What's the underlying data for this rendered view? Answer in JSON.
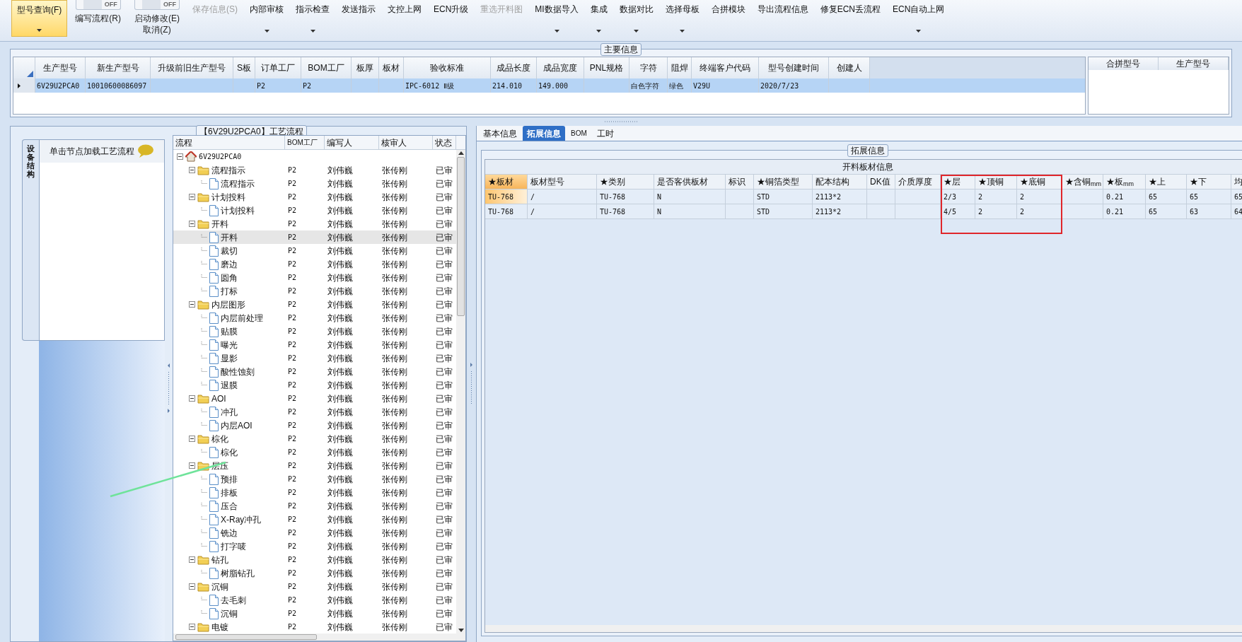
{
  "toolbar": [
    {
      "kind": "button",
      "label": "型号查询(F)",
      "selected": true,
      "dropdown": true,
      "disabled": false
    },
    {
      "kind": "toggle",
      "switch": "OFF",
      "label": "编写流程(R)",
      "on": false
    },
    {
      "kind": "toggle",
      "switch": "OFF",
      "label": "启动修改(E)",
      "sublabel": "取消(Z)",
      "on": false
    },
    {
      "kind": "button",
      "label": "保存信息(S)",
      "selected": false,
      "dropdown": false,
      "disabled": true
    },
    {
      "kind": "button",
      "label": "内部审核",
      "selected": false,
      "dropdown": true,
      "disabled": false
    },
    {
      "kind": "button",
      "label": "指示检查",
      "selected": false,
      "dropdown": true,
      "disabled": false
    },
    {
      "kind": "button",
      "label": "发送指示",
      "selected": false,
      "dropdown": false,
      "disabled": false
    },
    {
      "kind": "button",
      "label": "文控上网",
      "selected": false,
      "dropdown": false,
      "disabled": false
    },
    {
      "kind": "button",
      "label": "ECN升级",
      "selected": false,
      "dropdown": false,
      "disabled": false
    },
    {
      "kind": "button",
      "label": "重选开料图",
      "selected": false,
      "dropdown": false,
      "disabled": true
    },
    {
      "kind": "button",
      "label": "MI数据导入",
      "selected": false,
      "dropdown": true,
      "disabled": false
    },
    {
      "kind": "button",
      "label": "集成",
      "selected": false,
      "dropdown": true,
      "disabled": false
    },
    {
      "kind": "button",
      "label": "数据对比",
      "selected": false,
      "dropdown": true,
      "disabled": false
    },
    {
      "kind": "button",
      "label": "选择母板",
      "selected": false,
      "dropdown": true,
      "disabled": false
    },
    {
      "kind": "button",
      "label": "合拼模块",
      "selected": false,
      "dropdown": false,
      "disabled": false
    },
    {
      "kind": "button",
      "label": "导出流程信息",
      "selected": false,
      "dropdown": false,
      "disabled": false
    },
    {
      "kind": "button",
      "label": "修复ECN丢流程",
      "selected": false,
      "dropdown": false,
      "disabled": false
    },
    {
      "kind": "button",
      "label": "ECN自动上网",
      "selected": false,
      "dropdown": true,
      "disabled": false
    }
  ],
  "main_info": {
    "title": "主要信息",
    "columns": [
      "生产型号",
      "新生产型号",
      "升级前旧生产型号",
      "S板",
      "订单工厂",
      "BOM工厂",
      "板厚",
      "板材",
      "验收标准",
      "成品长度",
      "成品宽度",
      "PNL规格",
      "字符",
      "阻焊",
      "终端客户代码",
      "型号创建时间",
      "创建人"
    ],
    "rows": [
      {
        "selected": true,
        "cells": [
          "6V29U2PCA0",
          "10010600086097",
          null,
          null,
          "P2",
          "P2",
          null,
          null,
          "IPC-6012 Ⅱ级",
          "214.010",
          "149.000",
          null,
          "白色字符",
          "绿色",
          "V29U",
          "2020/7/23",
          null
        ]
      }
    ],
    "merge_table": {
      "columns": [
        "合拼型号",
        "生产型号"
      ]
    }
  },
  "side_tab": {
    "label": "设备结构",
    "hint": "单击节点加载工艺流程"
  },
  "flow": {
    "title": "【6V29U2PCA0】工艺流程",
    "columns": [
      "流程",
      "BOM工厂",
      "编写人",
      "核审人",
      "状态"
    ],
    "tree": [
      {
        "kind": "root",
        "label": "6V29U2PCA0",
        "expanded": true,
        "selected": false,
        "children": [
          {
            "kind": "folder",
            "label": "流程指示",
            "bom": "P2",
            "writer": "刘伟巍",
            "reviewer": "张传刚",
            "status": "已审",
            "expanded": true,
            "selected": false,
            "children": [
              {
                "kind": "file",
                "label": "流程指示",
                "bom": "P2",
                "writer": "刘伟巍",
                "reviewer": "张传刚",
                "status": "已审",
                "selected": false
              }
            ]
          },
          {
            "kind": "folder",
            "label": "计划投料",
            "bom": "P2",
            "writer": "刘伟巍",
            "reviewer": "张传刚",
            "status": "已审",
            "expanded": true,
            "selected": false,
            "children": [
              {
                "kind": "file",
                "label": "计划投料",
                "bom": "P2",
                "writer": "刘伟巍",
                "reviewer": "张传刚",
                "status": "已审",
                "selected": false
              }
            ]
          },
          {
            "kind": "folder",
            "label": "开料",
            "bom": "P2",
            "writer": "刘伟巍",
            "reviewer": "张传刚",
            "status": "已审",
            "expanded": true,
            "selected": false,
            "children": [
              {
                "kind": "file",
                "label": "开料",
                "bom": "P2",
                "writer": "刘伟巍",
                "reviewer": "张传刚",
                "status": "已审",
                "selected": true
              },
              {
                "kind": "file",
                "label": "裁切",
                "bom": "P2",
                "writer": "刘伟巍",
                "reviewer": "张传刚",
                "status": "已审",
                "selected": false
              },
              {
                "kind": "file",
                "label": "磨边",
                "bom": "P2",
                "writer": "刘伟巍",
                "reviewer": "张传刚",
                "status": "已审",
                "selected": false
              },
              {
                "kind": "file",
                "label": "圆角",
                "bom": "P2",
                "writer": "刘伟巍",
                "reviewer": "张传刚",
                "status": "已审",
                "selected": false
              },
              {
                "kind": "file",
                "label": "打标",
                "bom": "P2",
                "writer": "刘伟巍",
                "reviewer": "张传刚",
                "status": "已审",
                "selected": false
              }
            ]
          },
          {
            "kind": "folder",
            "label": "内层图形",
            "bom": "P2",
            "writer": "刘伟巍",
            "reviewer": "张传刚",
            "status": "已审",
            "expanded": true,
            "selected": false,
            "children": [
              {
                "kind": "file",
                "label": "内层前处理",
                "bom": "P2",
                "writer": "刘伟巍",
                "reviewer": "张传刚",
                "status": "已审",
                "selected": false
              },
              {
                "kind": "file",
                "label": "贴膜",
                "bom": "P2",
                "writer": "刘伟巍",
                "reviewer": "张传刚",
                "status": "已审",
                "selected": false
              },
              {
                "kind": "file",
                "label": "曝光",
                "bom": "P2",
                "writer": "刘伟巍",
                "reviewer": "张传刚",
                "status": "已审",
                "selected": false
              },
              {
                "kind": "file",
                "label": "显影",
                "bom": "P2",
                "writer": "刘伟巍",
                "reviewer": "张传刚",
                "status": "已审",
                "selected": false
              },
              {
                "kind": "file",
                "label": "酸性蚀刻",
                "bom": "P2",
                "writer": "刘伟巍",
                "reviewer": "张传刚",
                "status": "已审",
                "selected": false
              },
              {
                "kind": "file",
                "label": "退膜",
                "bom": "P2",
                "writer": "刘伟巍",
                "reviewer": "张传刚",
                "status": "已审",
                "selected": false
              }
            ]
          },
          {
            "kind": "folder",
            "label": "AOI",
            "bom": "P2",
            "writer": "刘伟巍",
            "reviewer": "张传刚",
            "status": "已审",
            "expanded": true,
            "selected": false,
            "children": [
              {
                "kind": "file",
                "label": "冲孔",
                "bom": "P2",
                "writer": "刘伟巍",
                "reviewer": "张传刚",
                "status": "已审",
                "selected": false
              },
              {
                "kind": "file",
                "label": "内层AOI",
                "bom": "P2",
                "writer": "刘伟巍",
                "reviewer": "张传刚",
                "status": "已审",
                "selected": false
              }
            ]
          },
          {
            "kind": "folder",
            "label": "棕化",
            "bom": "P2",
            "writer": "刘伟巍",
            "reviewer": "张传刚",
            "status": "已审",
            "expanded": true,
            "selected": false,
            "children": [
              {
                "kind": "file",
                "label": "棕化",
                "bom": "P2",
                "writer": "刘伟巍",
                "reviewer": "张传刚",
                "status": "已审",
                "selected": false
              }
            ]
          },
          {
            "kind": "folder",
            "label": "层压",
            "bom": "P2",
            "writer": "刘伟巍",
            "reviewer": "张传刚",
            "status": "已审",
            "expanded": true,
            "selected": false,
            "children": [
              {
                "kind": "file",
                "label": "预排",
                "bom": "P2",
                "writer": "刘伟巍",
                "reviewer": "张传刚",
                "status": "已审",
                "selected": false
              },
              {
                "kind": "file",
                "label": "排板",
                "bom": "P2",
                "writer": "刘伟巍",
                "reviewer": "张传刚",
                "status": "已审",
                "selected": false
              },
              {
                "kind": "file",
                "label": "压合",
                "bom": "P2",
                "writer": "刘伟巍",
                "reviewer": "张传刚",
                "status": "已审",
                "selected": false
              },
              {
                "kind": "file",
                "label": "X-Ray冲孔",
                "bom": "P2",
                "writer": "刘伟巍",
                "reviewer": "张传刚",
                "status": "已审",
                "selected": false
              },
              {
                "kind": "file",
                "label": "铣边",
                "bom": "P2",
                "writer": "刘伟巍",
                "reviewer": "张传刚",
                "status": "已审",
                "selected": false
              },
              {
                "kind": "file",
                "label": "打字唛",
                "bom": "P2",
                "writer": "刘伟巍",
                "reviewer": "张传刚",
                "status": "已审",
                "selected": false
              }
            ]
          },
          {
            "kind": "folder",
            "label": "钻孔",
            "bom": "P2",
            "writer": "刘伟巍",
            "reviewer": "张传刚",
            "status": "已审",
            "expanded": true,
            "selected": false,
            "children": [
              {
                "kind": "file",
                "label": "树脂钻孔",
                "bom": "P2",
                "writer": "刘伟巍",
                "reviewer": "张传刚",
                "status": "已审",
                "selected": false
              }
            ]
          },
          {
            "kind": "folder",
            "label": "沉铜",
            "bom": "P2",
            "writer": "刘伟巍",
            "reviewer": "张传刚",
            "status": "已审",
            "expanded": true,
            "selected": false,
            "children": [
              {
                "kind": "file",
                "label": "去毛刺",
                "bom": "P2",
                "writer": "刘伟巍",
                "reviewer": "张传刚",
                "status": "已审",
                "selected": false
              },
              {
                "kind": "file",
                "label": "沉铜",
                "bom": "P2",
                "writer": "刘伟巍",
                "reviewer": "张传刚",
                "status": "已审",
                "selected": false
              }
            ]
          },
          {
            "kind": "folder",
            "label": "电镀",
            "bom": "P2",
            "writer": "刘伟巍",
            "reviewer": "张传刚",
            "status": "已审",
            "expanded": true,
            "selected": false
          }
        ]
      }
    ]
  },
  "detail": {
    "tabs": [
      {
        "label": "基本信息",
        "selected": false
      },
      {
        "label": "拓展信息",
        "selected": true
      },
      {
        "label": "BOM",
        "selected": false
      },
      {
        "label": "工时",
        "selected": false
      }
    ],
    "group_title": "拓展信息",
    "table_title": "开料板材信息",
    "columns": [
      {
        "label": "★板材",
        "selected": true
      },
      {
        "label": "板材型号",
        "selected": false
      },
      {
        "label": "★类别",
        "selected": false
      },
      {
        "label": "是否客供板材",
        "selected": false
      },
      {
        "label": "标识",
        "selected": false
      },
      {
        "label": "★铜箔类型",
        "selected": false
      },
      {
        "label": "配本结构",
        "selected": false
      },
      {
        "label": "DK值",
        "selected": false
      },
      {
        "label": "介质厚度",
        "selected": false
      },
      {
        "label": "★层",
        "selected": false
      },
      {
        "label": "★顶铜",
        "selected": false
      },
      {
        "label": "★底铜",
        "selected": false
      },
      {
        "label": "★含铜$_{mm}$",
        "selected": false
      },
      {
        "label": "★板$_{mm}$",
        "selected": false
      },
      {
        "label": "★上",
        "selected": false
      },
      {
        "label": "★下",
        "selected": false
      },
      {
        "label": "均",
        "selected": false
      }
    ],
    "rows": [
      [
        "TU-768",
        "/",
        "TU-768",
        "N",
        null,
        "STD",
        "2113*2",
        null,
        null,
        "2/3",
        "2",
        "2",
        null,
        "0.21",
        "65",
        "65",
        "65"
      ],
      [
        "TU-768",
        "/",
        "TU-768",
        "N",
        null,
        "STD",
        "2113*2",
        null,
        null,
        "4/5",
        "2",
        "2",
        null,
        "0.21",
        "65",
        "63",
        "64"
      ]
    ]
  }
}
